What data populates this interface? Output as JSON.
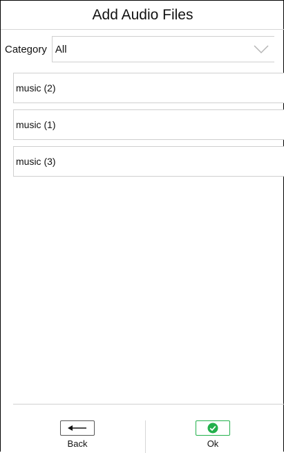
{
  "header": {
    "title": "Add Audio Files"
  },
  "category": {
    "label": "Category",
    "selected": "All"
  },
  "files": [
    {
      "name": "music (2)"
    },
    {
      "name": "music (1)"
    },
    {
      "name": "music (3)"
    }
  ],
  "footer": {
    "back_label": "Back",
    "ok_label": "Ok"
  },
  "colors": {
    "ok_accent": "#22b04b",
    "border": "#cfcfcf"
  },
  "icons": {
    "back": "arrow-left-icon",
    "ok": "check-circle-icon",
    "dropdown": "chevron-down-icon"
  }
}
